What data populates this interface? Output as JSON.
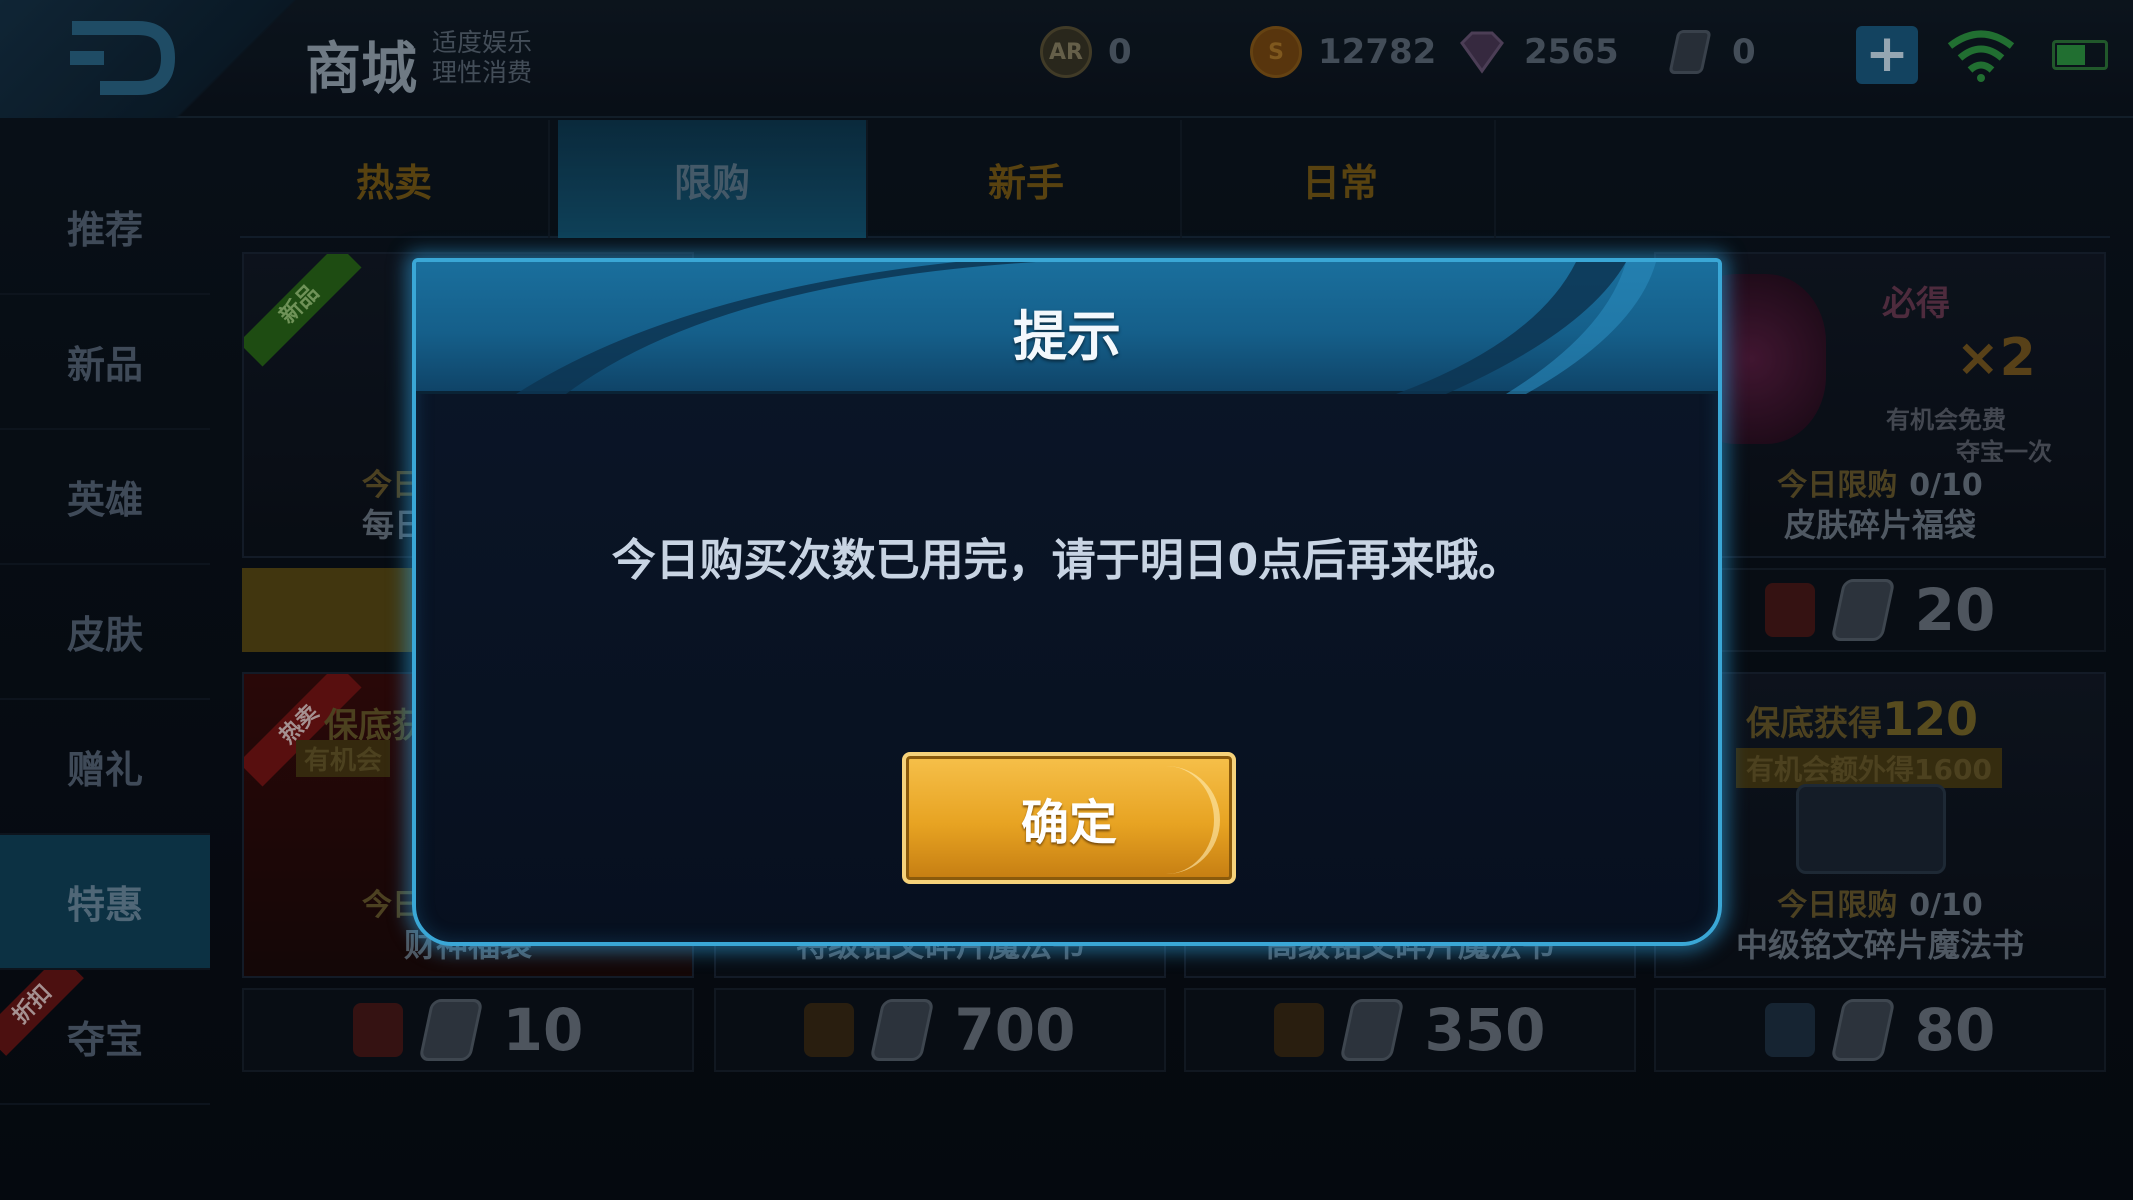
{
  "shop": {
    "title": "商城",
    "subtitle_line1": "适度娱乐",
    "subtitle_line2": "理性消费"
  },
  "currencies": [
    {
      "icon": "honor-token-icon",
      "label": "AR",
      "value": "0"
    },
    {
      "icon": "gold-coin-icon",
      "label": "S",
      "value": "12782"
    },
    {
      "icon": "diamond-icon",
      "label": "",
      "value": "2565"
    },
    {
      "icon": "voucher-icon",
      "label": "",
      "value": "0"
    }
  ],
  "plus_label": "+",
  "side_nav": [
    "推荐",
    "新品",
    "英雄",
    "皮肤",
    "赠礼",
    "特惠",
    "夺宝"
  ],
  "side_nav_active": "特惠",
  "side_nav_tag": "折扣",
  "tabs": [
    "热卖",
    "限购",
    "新手",
    "日常"
  ],
  "tab_active": "限购",
  "cards_top": [
    {
      "badge": "新品",
      "limit_label": "今日",
      "name": "每日",
      "price": ""
    },
    {
      "limit_label": "今日限购",
      "limit_count": "0/10",
      "name": "皮肤碎片福袋",
      "price": "20",
      "promo_line1": "必得",
      "promo_line2": "×2",
      "promo_line3": "有机会免费",
      "promo_line4": "夺宝一次"
    }
  ],
  "cards_bottom": [
    {
      "badge": "热卖",
      "promo": "保底获",
      "promo2": "有机会",
      "limit_label": "今日",
      "name": "财神福袋",
      "price": "10"
    },
    {
      "name": "特级铭文碎片魔法书",
      "price": "700"
    },
    {
      "name": "高级铭文碎片魔法书",
      "price": "350"
    },
    {
      "promo": "保底获得",
      "promo_num": "120",
      "promo2": "有机会额外得1600",
      "limit_label": "今日限购",
      "limit_count": "0/10",
      "name": "中级铭文碎片魔法书",
      "price": "80"
    }
  ],
  "dialog": {
    "title": "提示",
    "message": "今日购买次数已用完，请于明日0点后再来哦。",
    "confirm_label": "确定"
  },
  "colors": {
    "dialog_border": "#3aa7d6",
    "dialog_header": "#1a6f9d",
    "confirm_button": "#e7a322",
    "tab_text": "#7a5c17",
    "status_wifi": "#2e9a44"
  }
}
